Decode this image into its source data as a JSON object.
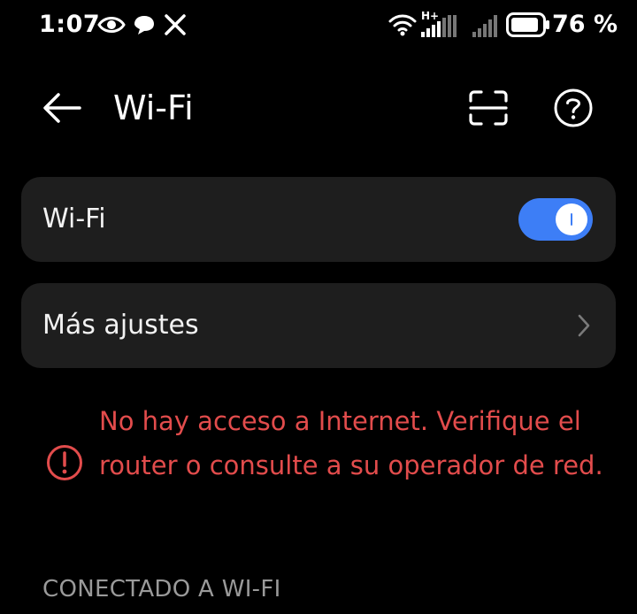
{
  "status_bar": {
    "time": "1:07",
    "battery_percent": "76 %",
    "network_type": "H+",
    "icons": [
      "eye-icon",
      "chat-bubble-icon",
      "x-logo-icon",
      "wifi-icon",
      "cell-signal-icon",
      "cell-signal-2-icon",
      "battery-icon"
    ]
  },
  "header": {
    "title": "Wi-Fi"
  },
  "wifi_card": {
    "label": "Wi-Fi",
    "enabled": true
  },
  "more_card": {
    "label": "Más ajustes"
  },
  "warning": {
    "text": "No hay acceso a Internet. Verifique el router o consulte a su operador de red."
  },
  "section": {
    "title": "CONECTADO A WI-FI"
  },
  "colors": {
    "background": "#000000",
    "card": "#1e1e1e",
    "accent": "#3d7ef6",
    "warning": "#e24c4c",
    "section_text": "#9a9a9a"
  }
}
